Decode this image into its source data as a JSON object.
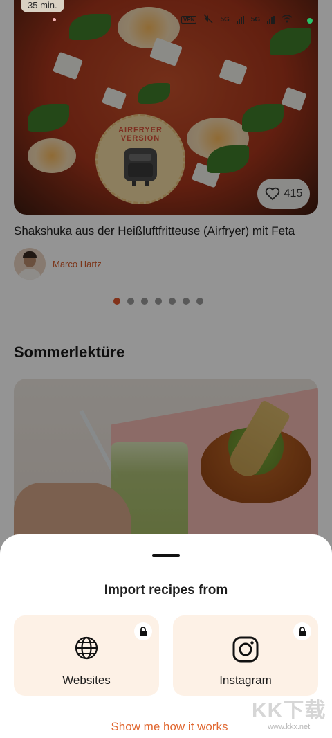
{
  "status_bar": {
    "time_chip": "35 min.",
    "vpn": "VPN",
    "net1": "5G",
    "net2": "5G"
  },
  "featured": {
    "badge_text": "AIRFRYER VERSION",
    "likes": "415",
    "title": "Shakshuka aus der Heißluftfritteuse (Airfryer) mit Feta",
    "author": "Marco Hartz",
    "carousel": {
      "total": 7,
      "active_index": 0
    }
  },
  "section": {
    "title": "Sommerlektüre"
  },
  "sheet": {
    "title": "Import recipes from",
    "options": [
      {
        "label": "Websites",
        "icon": "globe-icon",
        "locked": true
      },
      {
        "label": "Instagram",
        "icon": "instagram-icon",
        "locked": true
      }
    ],
    "link": "Show me how it works"
  },
  "watermark": {
    "main": "KK下载",
    "sub": "www.kkx.net"
  },
  "colors": {
    "accent": "#e0572d",
    "link": "#e0662f",
    "option_bg": "#fdf1e6",
    "author_name": "#d45a2a"
  }
}
